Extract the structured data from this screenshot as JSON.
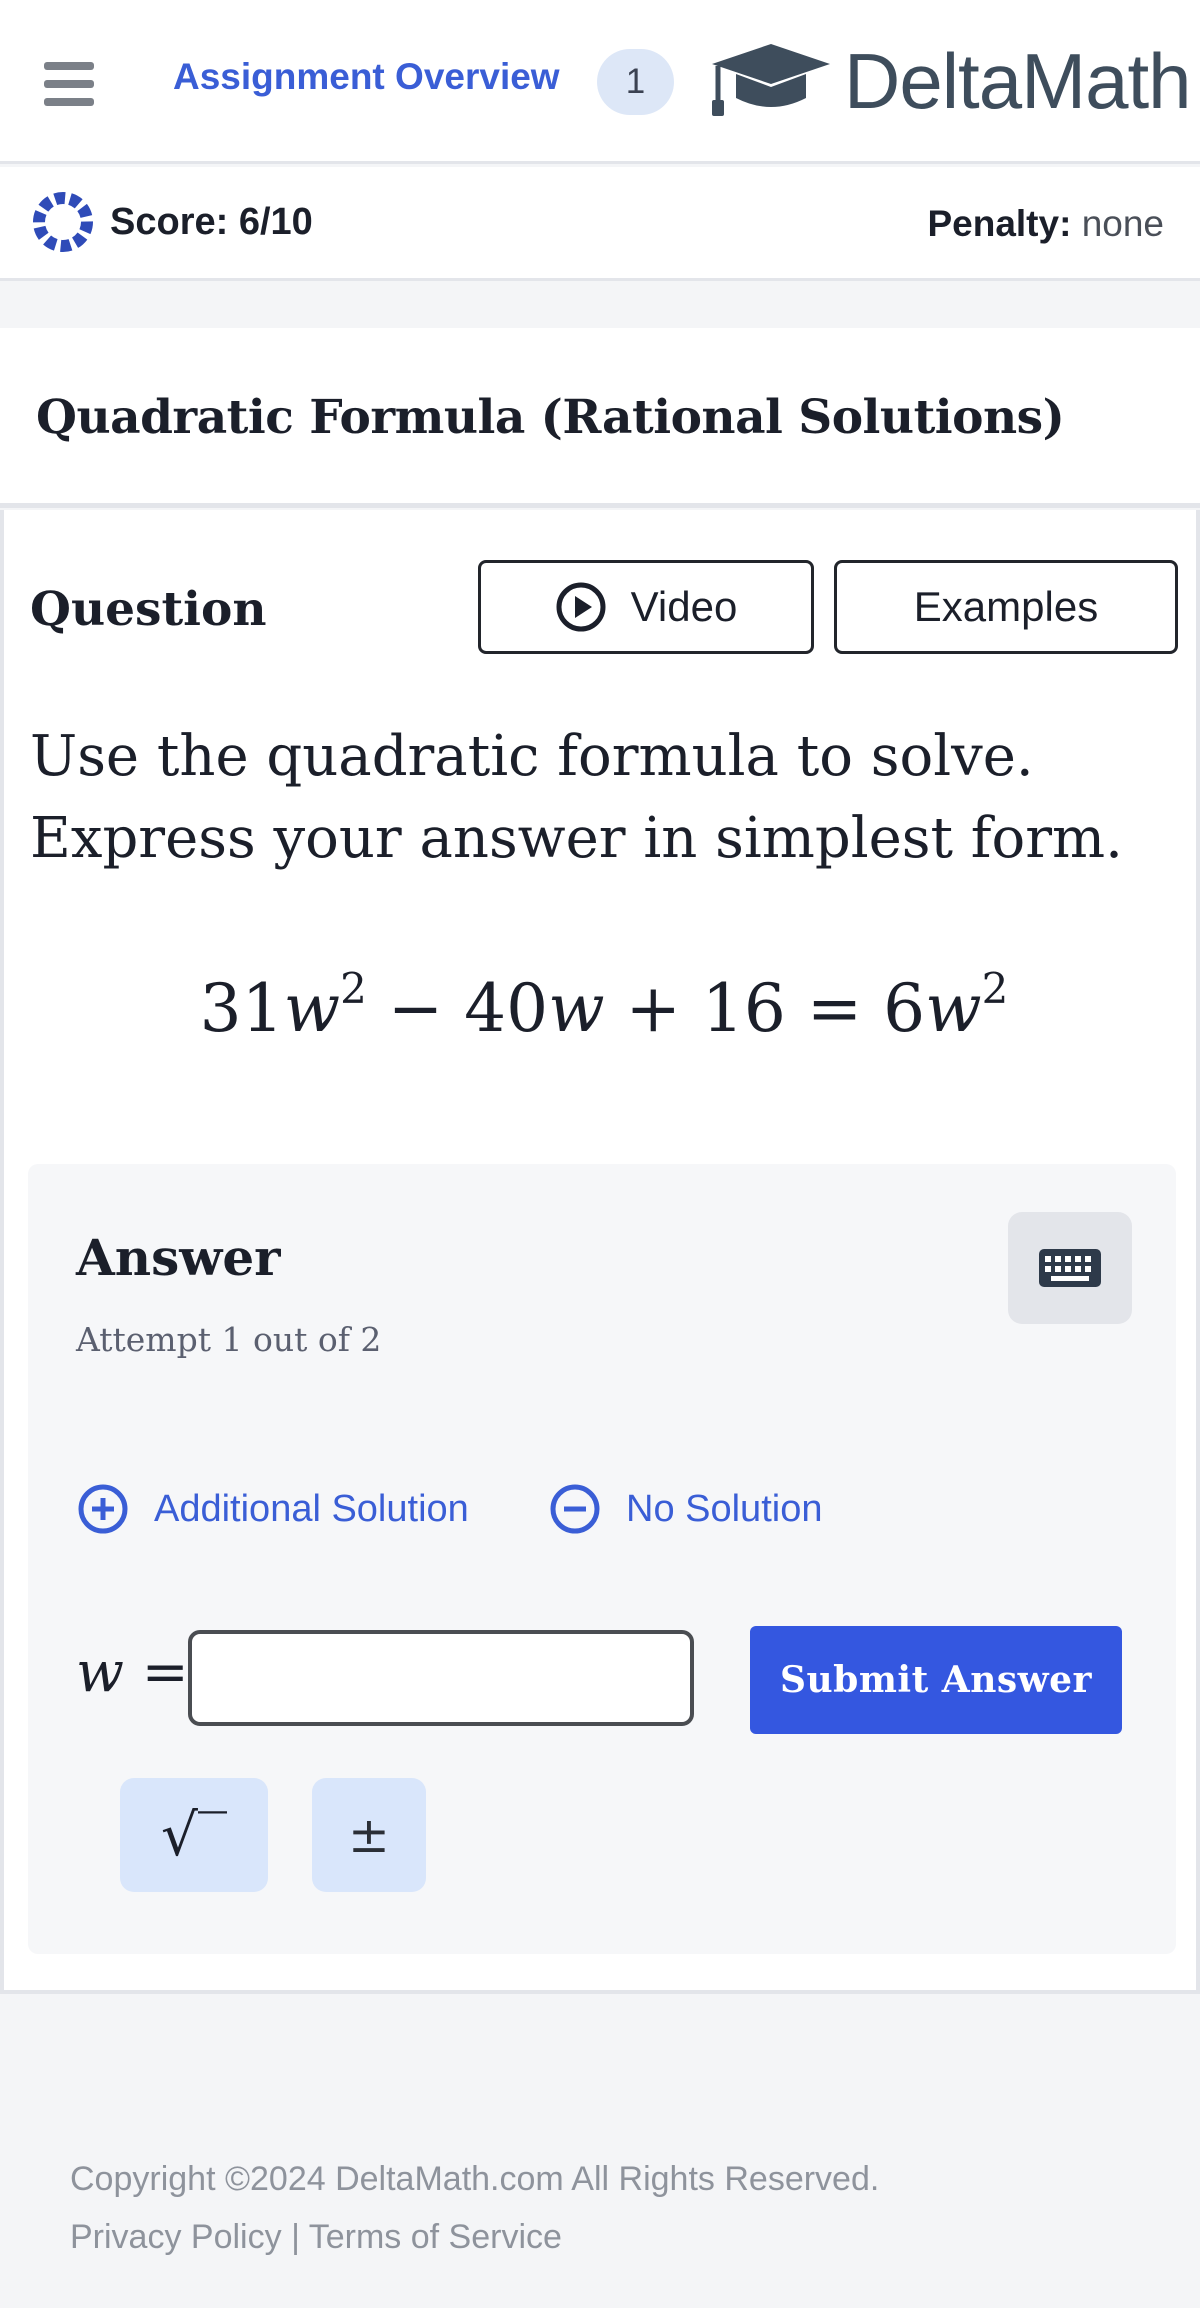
{
  "header": {
    "menu_icon": "hamburger-menu-icon",
    "overview_label": "Assignment Overview",
    "overview_badge": "1",
    "logo_icon": "graduation-cap-icon",
    "logo_text": "DeltaMath"
  },
  "scorebar": {
    "progress_icon": "progress-ring-icon",
    "score_text": "Score: 6/10",
    "penalty_label": "Penalty:",
    "penalty_value": "none"
  },
  "problem": {
    "title": "Quadratic Formula (Rational Solutions)"
  },
  "question": {
    "label": "Question",
    "video_label": "Video",
    "video_icon": "play-circle-icon",
    "examples_label": "Examples",
    "instruction_line1": "Use the quadratic formula to solve.",
    "instruction_line2": "Express your answer in simplest form.",
    "equation": {
      "lhs_coef1": "31",
      "var": "w",
      "exp": "2",
      "minus": "−",
      "lhs_coef2": "40",
      "plus": "+",
      "const": "16",
      "equals": "=",
      "rhs_coef": "6"
    }
  },
  "answer": {
    "title": "Answer",
    "attempt": "Attempt 1 out of 2",
    "keyboard_icon": "keyboard-icon",
    "additional_solution_label": "Additional Solution",
    "additional_solution_icon": "plus-circle-icon",
    "no_solution_label": "No Solution",
    "no_solution_icon": "minus-circle-icon",
    "variable": "w",
    "equals": "=",
    "input_value": "",
    "submit_label": "Submit Answer",
    "sqrt_symbol": "√‾",
    "plusminus_symbol": "±"
  },
  "footer": {
    "copyright": "Copyright ©2024 DeltaMath.com All Rights Reserved.",
    "privacy_label": "Privacy Policy",
    "separator": "|",
    "terms_label": "Terms of Service"
  },
  "colors": {
    "accent": "#3457e0",
    "link": "#3a5ed6",
    "badge_bg": "#dde7f7",
    "symbol_btn_bg": "#d9e6fb"
  }
}
